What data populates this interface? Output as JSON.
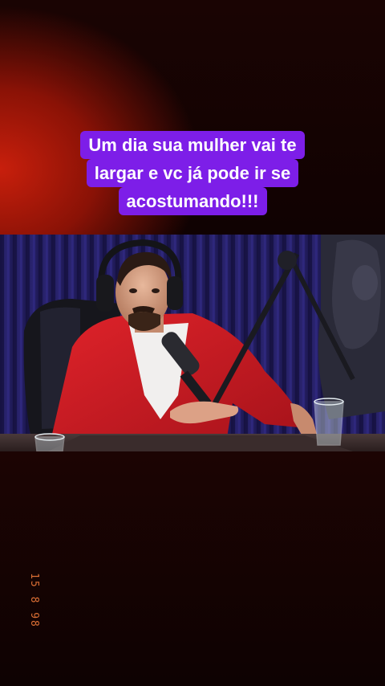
{
  "caption": {
    "lines": [
      "Um dia sua mulher vai te",
      "largar e vc já pode ir se",
      "acostumando!!!"
    ],
    "background_color": "#7d1ee8",
    "text_color": "#ffffff"
  },
  "datestamp": "15 8 98",
  "colors": {
    "background_red": "#c81f0c",
    "jacket_red": "#d01a1e",
    "curtain_blue": "#2a2470"
  }
}
